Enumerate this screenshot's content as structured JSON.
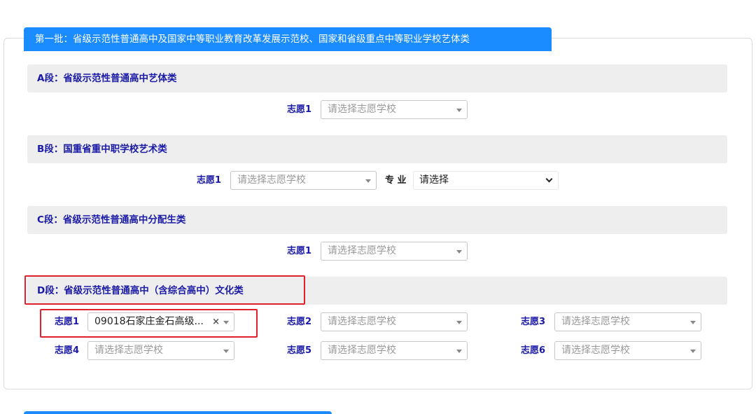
{
  "batch": {
    "title": "第一批：省级示范性普通高中及国家中等职业教育改革发展示范校、国家和省级重点中等职业学校艺体类"
  },
  "sections": {
    "a": {
      "title": "A段：省级示范性普通高中艺体类"
    },
    "b": {
      "title": "B段：国重省重中职学校艺术类"
    },
    "c": {
      "title": "C段：省级示范性普通高中分配生类"
    },
    "d": {
      "title": "D段：省级示范性普通高中（含综合高中）文化类"
    }
  },
  "choices": {
    "a1": {
      "label": "志愿1",
      "placeholder": "请选择志愿学校"
    },
    "b1": {
      "label": "志愿1",
      "placeholder": "请选择志愿学校"
    },
    "b_major": {
      "label": "专 业",
      "value": "请选择"
    },
    "c1": {
      "label": "志愿1",
      "placeholder": "请选择志愿学校"
    },
    "d1": {
      "label": "志愿1",
      "value": "09018石家庄金石高级..."
    },
    "d2": {
      "label": "志愿2",
      "placeholder": "请选择志愿学校"
    },
    "d3": {
      "label": "志愿3",
      "placeholder": "请选择志愿学校"
    },
    "d4": {
      "label": "志愿4",
      "placeholder": "请选择志愿学校"
    },
    "d5": {
      "label": "志愿5",
      "placeholder": "请选择志愿学校"
    },
    "d6": {
      "label": "志愿6",
      "placeholder": "请选择志愿学校"
    }
  },
  "icons": {
    "clear": "×"
  },
  "colors": {
    "accent": "#1a8cff",
    "label": "#1a1aa6",
    "highlight": "#e0212b"
  }
}
